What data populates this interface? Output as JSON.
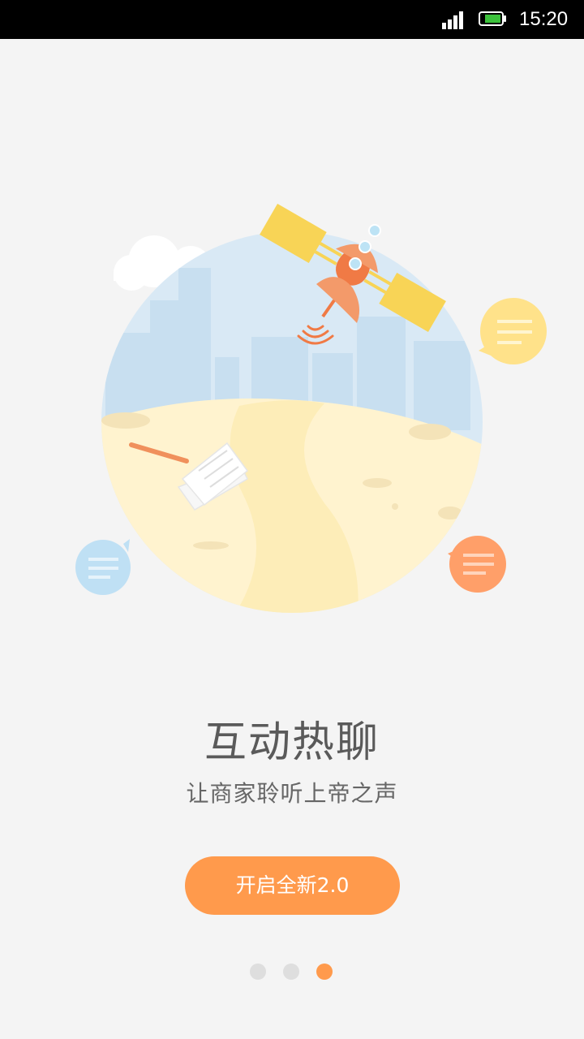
{
  "status_bar": {
    "time": "15:20",
    "signal_icon": "cell-signal-icon",
    "battery_icon": "battery-icon",
    "battery_level": 0.85
  },
  "onboarding": {
    "title": "互动热聊",
    "subtitle": "让商家聆听上帝之声",
    "button_label": "开启全新2.0",
    "page_count": 3,
    "current_page": 3
  },
  "colors": {
    "accent": "#ff9a4c",
    "background": "#f4f4f4",
    "dot_inactive": "#dedede"
  }
}
